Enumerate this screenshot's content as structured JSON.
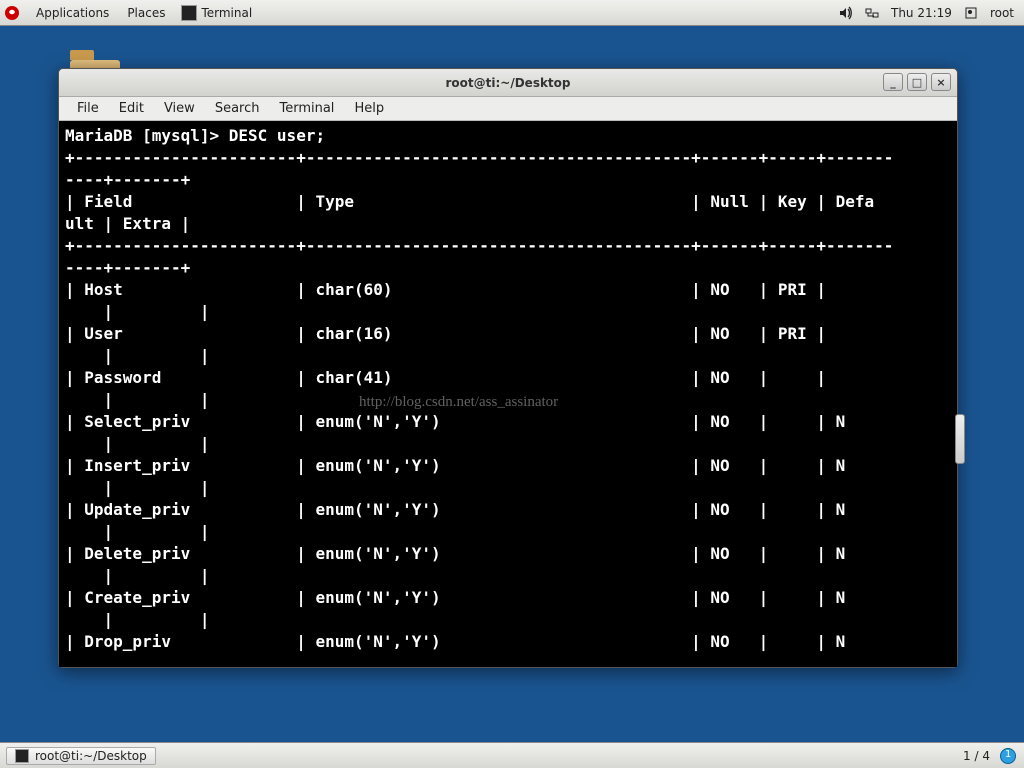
{
  "topbar": {
    "apps": "Applications",
    "places": "Places",
    "task_label": "Terminal",
    "clock": "Thu 21:19",
    "user": "root"
  },
  "window": {
    "title": "root@ti:~/Desktop",
    "menu": {
      "file": "File",
      "edit": "Edit",
      "view": "View",
      "search": "Search",
      "terminal": "Terminal",
      "help": "Help"
    }
  },
  "terminal": {
    "prompt": "MariaDB [mysql]> ",
    "command": "DESC user;",
    "headers": {
      "field": "Field",
      "type": "Type",
      "nul": "Null",
      "key": "Key",
      "default_frag1": "Defa",
      "default_frag2": "ult",
      "extra": "Extra"
    },
    "rows": [
      {
        "field": "Host",
        "type": "char(60)",
        "nul": "NO",
        "key": "PRI",
        "def": ""
      },
      {
        "field": "User",
        "type": "char(16)",
        "nul": "NO",
        "key": "PRI",
        "def": ""
      },
      {
        "field": "Password",
        "type": "char(41)",
        "nul": "NO",
        "key": "",
        "def": ""
      },
      {
        "field": "Select_priv",
        "type": "enum('N','Y')",
        "nul": "NO",
        "key": "",
        "def": "N"
      },
      {
        "field": "Insert_priv",
        "type": "enum('N','Y')",
        "nul": "NO",
        "key": "",
        "def": "N"
      },
      {
        "field": "Update_priv",
        "type": "enum('N','Y')",
        "nul": "NO",
        "key": "",
        "def": "N"
      },
      {
        "field": "Delete_priv",
        "type": "enum('N','Y')",
        "nul": "NO",
        "key": "",
        "def": "N"
      },
      {
        "field": "Create_priv",
        "type": "enum('N','Y')",
        "nul": "NO",
        "key": "",
        "def": "N"
      },
      {
        "field": "Drop_priv",
        "type": "enum('N','Y')",
        "nul": "NO",
        "key": "",
        "def": "N"
      }
    ]
  },
  "watermark": "http://blog.csdn.net/ass_assinator",
  "bottombar": {
    "task": "root@ti:~/Desktop",
    "pager": "1 / 4"
  }
}
